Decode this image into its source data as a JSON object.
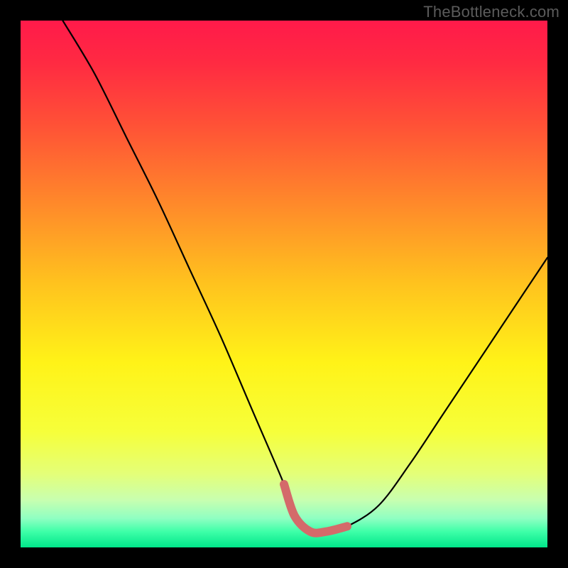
{
  "watermark": "TheBottleneck.com",
  "colors": {
    "background": "#000000",
    "curve_stroke": "#000000",
    "bottom_stroke": "#d46a6a",
    "gradient_stops": [
      {
        "offset": 0.0,
        "color": "#ff1a4a"
      },
      {
        "offset": 0.08,
        "color": "#ff2a42"
      },
      {
        "offset": 0.2,
        "color": "#ff5236"
      },
      {
        "offset": 0.35,
        "color": "#ff8a2a"
      },
      {
        "offset": 0.5,
        "color": "#ffc31e"
      },
      {
        "offset": 0.65,
        "color": "#fff318"
      },
      {
        "offset": 0.78,
        "color": "#f6ff3a"
      },
      {
        "offset": 0.86,
        "color": "#e4ff78"
      },
      {
        "offset": 0.91,
        "color": "#c8ffb0"
      },
      {
        "offset": 0.945,
        "color": "#8fffc2"
      },
      {
        "offset": 0.97,
        "color": "#3effa8"
      },
      {
        "offset": 1.0,
        "color": "#00e68a"
      }
    ]
  },
  "chart_data": {
    "type": "line",
    "title": "",
    "xlabel": "",
    "ylabel": "",
    "xlim": [
      0,
      100
    ],
    "ylim": [
      0,
      100
    ],
    "series": [
      {
        "name": "bottleneck-curve",
        "x": [
          8,
          14,
          20,
          26,
          32,
          38,
          44,
          50,
          52,
          55,
          58,
          62,
          68,
          74,
          80,
          88,
          96,
          100
        ],
        "y": [
          100,
          90,
          78,
          66,
          53,
          40,
          26,
          12,
          6,
          3,
          3,
          4,
          8,
          16,
          25,
          37,
          49,
          55
        ]
      }
    ],
    "highlight_range_x": [
      46,
      62
    ],
    "highlight_stroke": "#d46a6a"
  }
}
